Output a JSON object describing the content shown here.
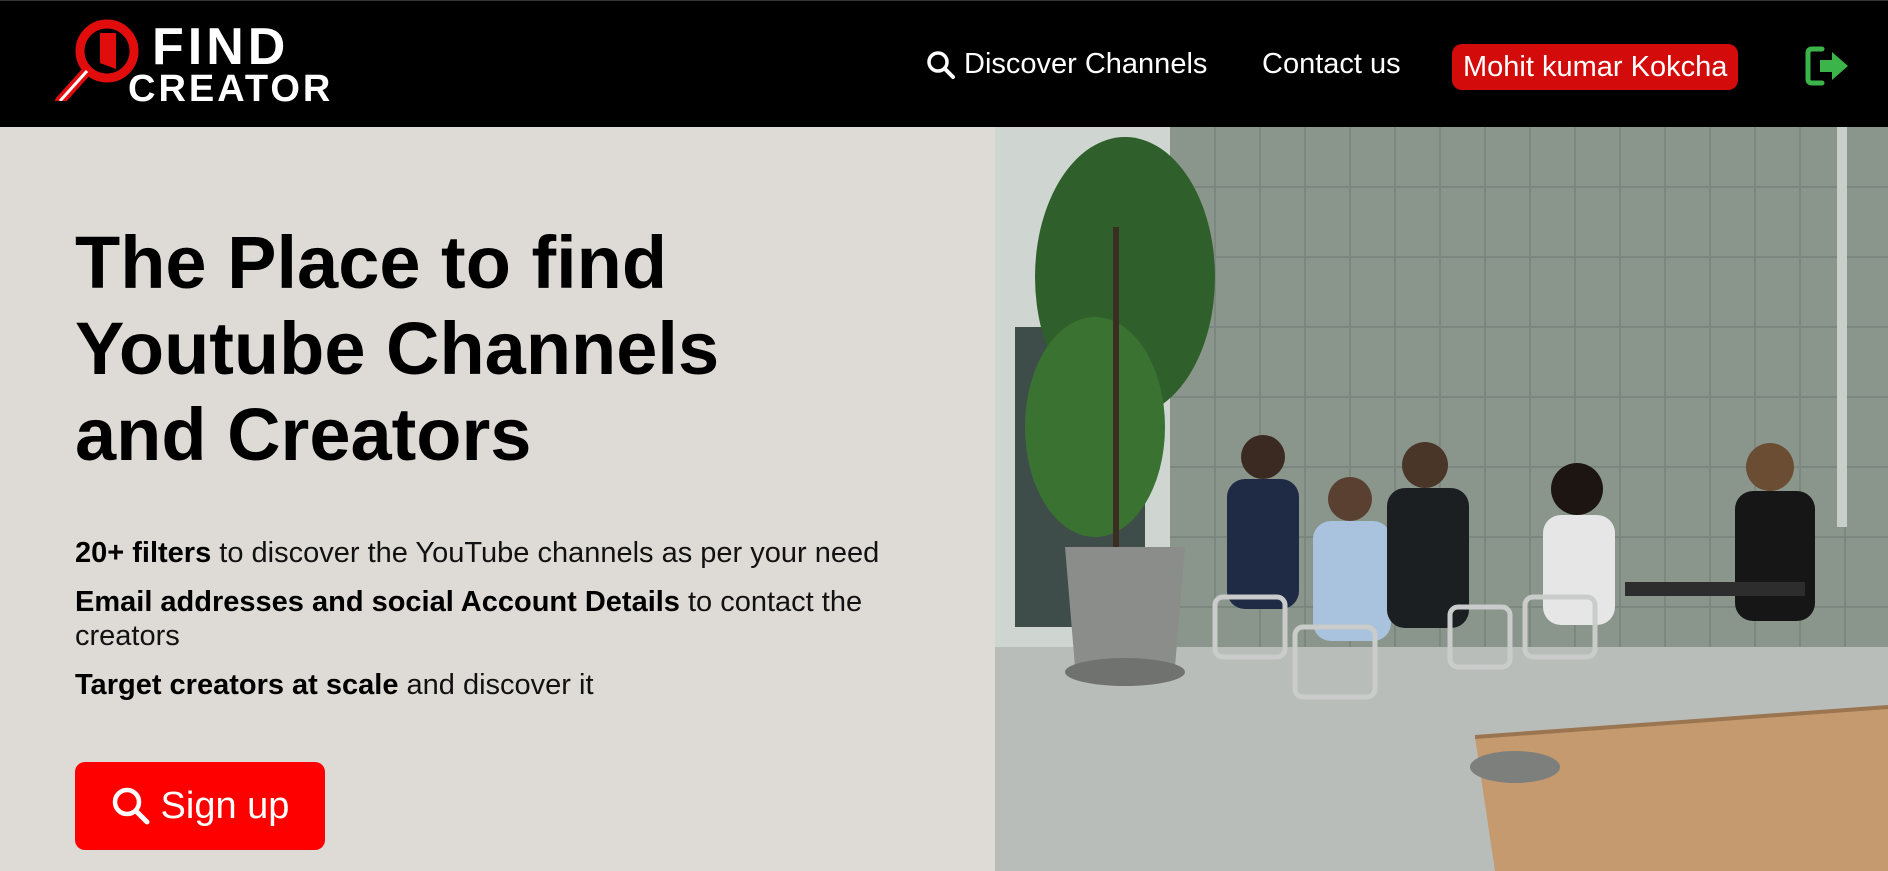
{
  "header": {
    "logo": {
      "line1": "FIND",
      "line2": "CREATOR"
    },
    "nav": {
      "discover_label": "Discover Channels",
      "contact_label": "Contact us",
      "user_name": "Mohit kumar Kokcha"
    }
  },
  "hero": {
    "title_lines": [
      "The Place to find",
      "Youtube Channels",
      "and Creators"
    ],
    "features": [
      {
        "bold": "20+ filters",
        "rest": " to discover the YouTube channels as per your need"
      },
      {
        "bold": "Email addresses and social Account Details",
        "rest": " to contact the creators"
      },
      {
        "bold": "Target creators at scale",
        "rest": " and discover it"
      }
    ],
    "signup_label": "Sign up"
  },
  "colors": {
    "accent_red": "#ff0000",
    "user_pill": "#d40b0b",
    "logout_green": "#3bb54a",
    "panel_bg": "#dedad6"
  },
  "icons": {
    "logo": "magnifier-logo-icon",
    "discover": "search-icon",
    "logout": "logout-icon",
    "signup": "search-icon"
  }
}
